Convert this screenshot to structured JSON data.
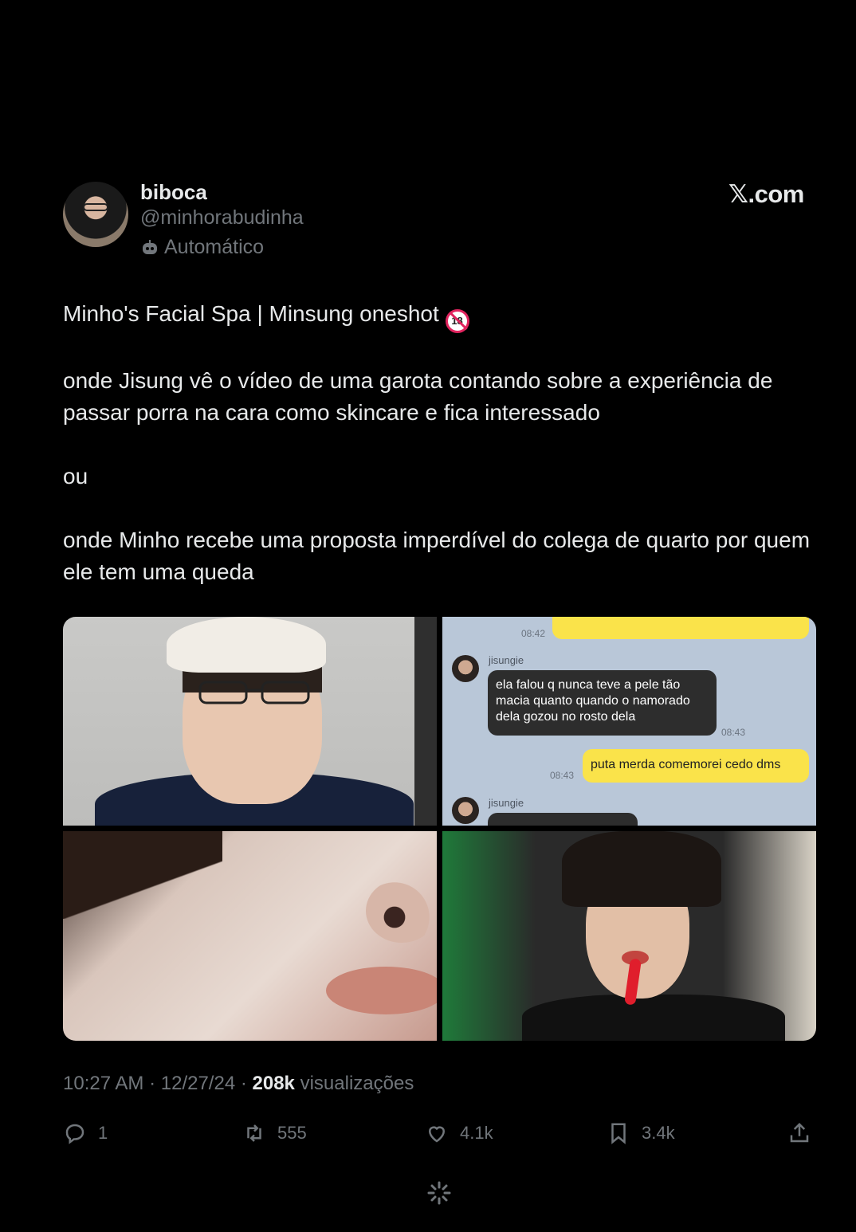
{
  "header": {
    "display_name": "biboca",
    "handle": "@minhorabudinha",
    "automated_label": "Automático",
    "site_label": "𝕏.com"
  },
  "tweet": {
    "line1": "Minho's Facial Spa | Minsung oneshot",
    "line1_badge": "18",
    "paragraph2": "onde Jisung vê o vídeo de uma garota contando sobre a experiência de passar porra na cara como skincare e fica interessado",
    "paragraph3": "ou",
    "paragraph4": "onde Minho recebe uma proposta imperdível do colega de quarto por quem ele tem uma queda"
  },
  "chat": {
    "time_top": "08:42",
    "name1": "jisungie",
    "msg1": "ela falou q nunca teve a pele tão macia quanto quando o namorado dela gozou no rosto dela",
    "time_msg1": "08:43",
    "time_msg2": "08:43",
    "msg2": "puta merda comemorei cedo dms",
    "name2": "jisungie"
  },
  "meta": {
    "time": "10:27 AM",
    "date": "12/27/24",
    "views_count": "208k",
    "views_label": "visualizações"
  },
  "actions": {
    "replies": "1",
    "retweets": "555",
    "likes": "4.1k",
    "bookmarks": "3.4k"
  },
  "colors": {
    "background": "#000000",
    "text": "#e7e9ea",
    "secondary": "#71767b",
    "chat_bg": "#b9c7d8",
    "bubble_out": "#fae34a"
  }
}
